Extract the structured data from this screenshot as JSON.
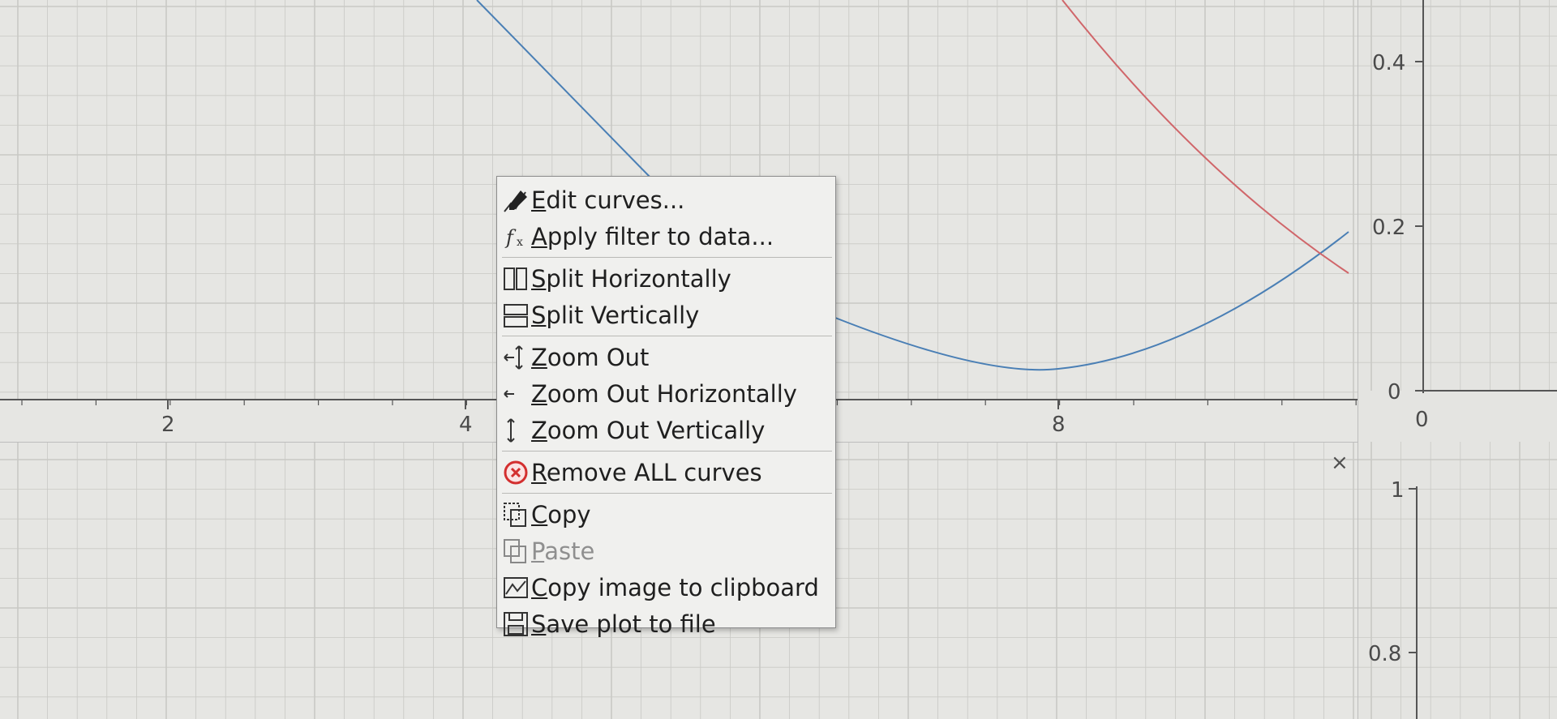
{
  "plot_top": {
    "x_ticks": [
      "2",
      "4",
      "8"
    ],
    "y_ticks": [
      "0.4",
      "0.2",
      "0"
    ],
    "x_axis_right_tick": "0",
    "curve_colors": {
      "blue": "#4a7fb5",
      "red": "#d0666a"
    }
  },
  "plot_bottom": {
    "y_ticks": [
      "1",
      "0.8"
    ],
    "close_label": "×"
  },
  "context_menu": {
    "items": [
      {
        "icon": "edit-curves-icon",
        "mnemonic": "E",
        "rest": "dit curves...",
        "enabled": true
      },
      {
        "icon": "function-filter-icon",
        "mnemonic": "A",
        "rest": "pply filter to data...",
        "enabled": true
      },
      {
        "icon": "split-horizontal-icon",
        "mnemonic": "S",
        "rest": "plit Horizontally",
        "enabled": true
      },
      {
        "icon": "split-vertical-icon",
        "mnemonic": "S",
        "rest": "plit Vertically",
        "enabled": true
      },
      {
        "icon": "zoom-out-icon",
        "mnemonic": "Z",
        "rest": "oom Out",
        "enabled": true
      },
      {
        "icon": "zoom-out-horizontal-icon",
        "mnemonic": "Z",
        "rest": "oom Out Horizontally",
        "enabled": true
      },
      {
        "icon": "zoom-out-vertical-icon",
        "mnemonic": "Z",
        "rest": "oom Out Vertically",
        "enabled": true
      },
      {
        "icon": "remove-icon",
        "mnemonic": "R",
        "rest": "emove ALL curves",
        "enabled": true
      },
      {
        "icon": "copy-icon",
        "mnemonic": "C",
        "rest": "opy",
        "enabled": true
      },
      {
        "icon": "paste-icon",
        "mnemonic": "P",
        "rest": "aste",
        "enabled": false
      },
      {
        "icon": "copy-image-icon",
        "mnemonic": "C",
        "rest": "opy image to clipboard",
        "enabled": true
      },
      {
        "icon": "save-icon",
        "mnemonic": "S",
        "rest": "ave plot to file",
        "enabled": true
      }
    ]
  },
  "colors": {
    "remove_icon": "#d32f2f",
    "grid": "#c6c6c2"
  }
}
